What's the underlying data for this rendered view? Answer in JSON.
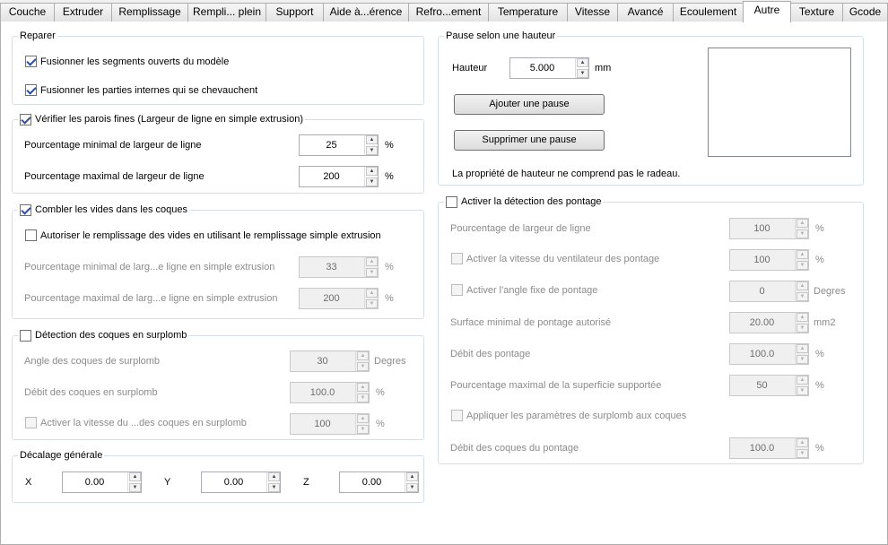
{
  "tabs": [
    {
      "label": "Couche",
      "active": false
    },
    {
      "label": "Extruder",
      "active": false
    },
    {
      "label": "Remplissage",
      "active": false
    },
    {
      "label": "Rempli... plein",
      "active": false
    },
    {
      "label": "Support",
      "active": false
    },
    {
      "label": "Aide à...érence",
      "active": false
    },
    {
      "label": "Refro...ement",
      "active": false
    },
    {
      "label": "Temperature",
      "active": false
    },
    {
      "label": "Vitesse",
      "active": false
    },
    {
      "label": "Avancé",
      "active": false
    },
    {
      "label": "Ecoulement",
      "active": false
    },
    {
      "label": "Autre",
      "active": true
    },
    {
      "label": "Texture",
      "active": false
    },
    {
      "label": "Gcode",
      "active": false
    }
  ],
  "repair": {
    "title": "Reparer",
    "merge_open": {
      "label": "Fusionner les segments ouverts du modèle",
      "checked": true
    },
    "merge_internal": {
      "label": "Fusionner les parties internes qui se chevauchent",
      "checked": true
    }
  },
  "thin_walls": {
    "title": "Vérifier les parois fines (Largeur de ligne en simple extrusion)",
    "checked": true,
    "min_label": "Pourcentage minimal de largeur de ligne",
    "min_value": "25",
    "min_unit": "%",
    "max_label": "Pourcentage maximal de largeur de ligne",
    "max_value": "200",
    "max_unit": "%"
  },
  "fill_gaps": {
    "title": "Combler les vides dans les coques",
    "checked": true,
    "single_extrusion": {
      "label": "Autoriser le remplissage des vides en utilisant le remplissage simple extrusion",
      "checked": false
    },
    "min_label": "Pourcentage minimal de larg...e ligne en simple extrusion",
    "min_value": "33",
    "min_unit": "%",
    "max_label": "Pourcentage maximal de larg...e ligne en simple extrusion",
    "max_value": "200",
    "max_unit": "%"
  },
  "overhang": {
    "title": "Détection des coques en surplomb",
    "checked": false,
    "angle_label": "Angle des coques de surplomb",
    "angle_value": "30",
    "angle_unit": "Degres",
    "flow_label": "Débit des coques en surplomb",
    "flow_value": "100.0",
    "flow_unit": "%",
    "fan_label": "Activer la vitesse du ...des coques en surplomb",
    "fan_checked": false,
    "fan_value": "100",
    "fan_unit": "%"
  },
  "offset": {
    "title": "Décalage générale",
    "x_label": "X",
    "x_value": "0.00",
    "y_label": "Y",
    "y_value": "0.00",
    "z_label": "Z",
    "z_value": "0.00"
  },
  "pause": {
    "title": "Pause selon une hauteur",
    "height_label": "Hauteur",
    "height_value": "5.000",
    "height_unit": "mm",
    "add_button": "Ajouter une pause",
    "remove_button": "Supprimer une pause",
    "note": "La propriété de hauteur ne comprend pas le radeau."
  },
  "bridge": {
    "title": "Activer la détection des pontage",
    "checked": false,
    "width_label": "Pourcentage de largeur de ligne",
    "width_value": "100",
    "width_unit": "%",
    "fan_label": "Activer la vitesse du ventilateur des pontage",
    "fan_checked": false,
    "fan_value": "100",
    "fan_unit": "%",
    "angle_label": "Activer l'angle fixe de pontage",
    "angle_checked": false,
    "angle_value": "0",
    "angle_unit": "Degres",
    "area_label": "Surface minimal de pontage autorisé",
    "area_value": "20.00",
    "area_unit": "mm2",
    "flow_label": "Débit des pontage",
    "flow_value": "100.0",
    "flow_unit": "%",
    "support_label": "Pourcentage maximal de la superficie supportée",
    "support_value": "50",
    "support_unit": "%",
    "apply_label": "Appliquer les paramètres de surplomb aux coques",
    "apply_checked": false,
    "shell_flow_label": "Débit des coques du pontage",
    "shell_flow_value": "100.0",
    "shell_flow_unit": "%"
  }
}
